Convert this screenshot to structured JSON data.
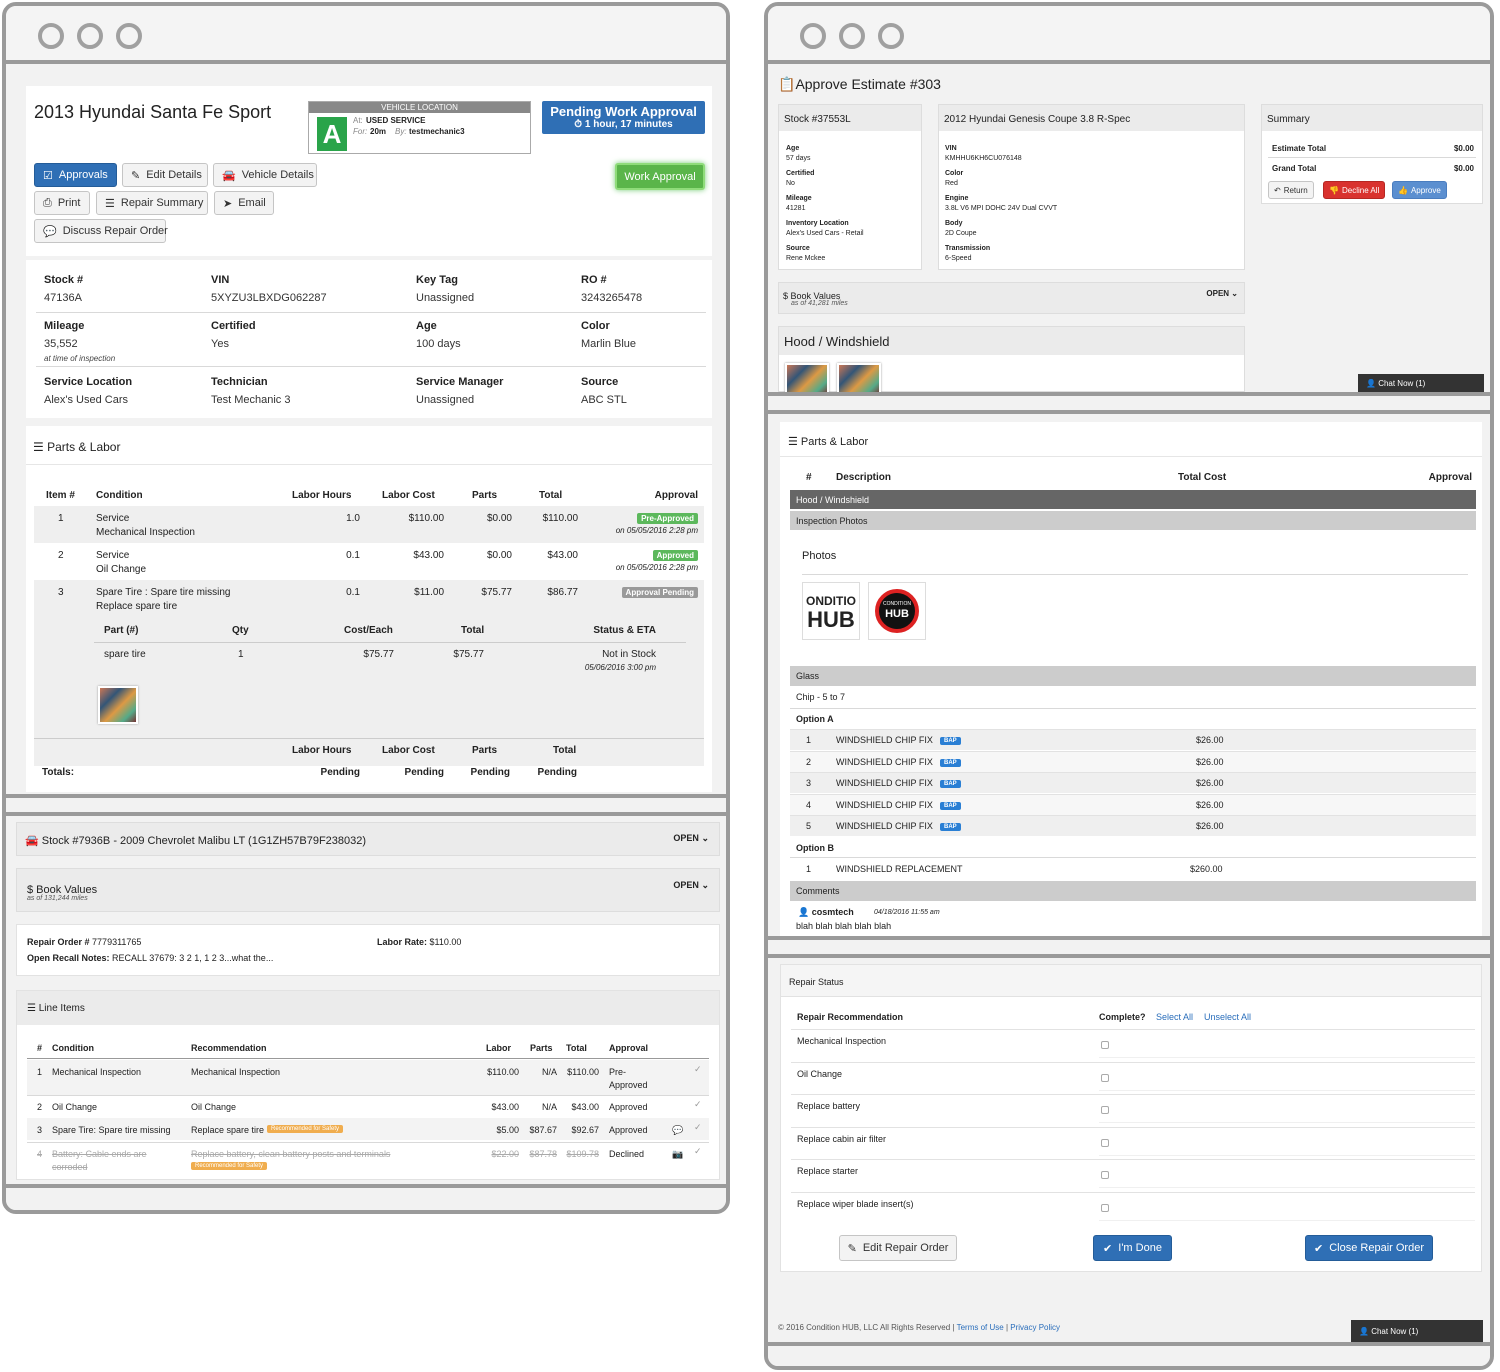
{
  "w1": {
    "vehicle_title": "2013 Hyundai Santa Fe Sport",
    "location_header": "VEHICLE LOCATION",
    "grade": "A",
    "at_label": "At:",
    "at_value": "USED SERVICE",
    "for_label": "For:",
    "for_value": "20m",
    "by_label": "By:",
    "by_value": "testmechanic3",
    "pending_title": "Pending Work Approval",
    "pending_time": "1 hour, 17 minutes",
    "work_approval": "Work Approval",
    "buttons": {
      "approvals": "Approvals",
      "edit": "Edit Details",
      "vehicle": "Vehicle Details",
      "print": "Print",
      "repair_summary": "Repair Summary",
      "email": "Email",
      "discuss": "Discuss Repair Order"
    },
    "info": [
      {
        "label": "Stock #",
        "value": "47136A"
      },
      {
        "label": "VIN",
        "value": "5XYZU3LBXDG062287"
      },
      {
        "label": "Key Tag",
        "value": "Unassigned"
      },
      {
        "label": "RO #",
        "value": "3243265478"
      },
      {
        "label": "Mileage",
        "value": "35,552",
        "note": "at time of inspection"
      },
      {
        "label": "Certified",
        "value": "Yes"
      },
      {
        "label": "Age",
        "value": "100 days"
      },
      {
        "label": "Color",
        "value": "Marlin Blue"
      },
      {
        "label": "Service Location",
        "value": "Alex's Used Cars"
      },
      {
        "label": "Technician",
        "value": "Test Mechanic 3"
      },
      {
        "label": "Service Manager",
        "value": "Unassigned"
      },
      {
        "label": "Source",
        "value": "ABC STL"
      }
    ],
    "parts_title": "Parts & Labor",
    "headers": [
      "Item #",
      "Condition",
      "Labor Hours",
      "Labor Cost",
      "Parts",
      "Total",
      "Approval"
    ],
    "rows": [
      {
        "n": "1",
        "c1": "Service",
        "c2": "Mechanical Inspection",
        "hours": "1.0",
        "cost": "$110.00",
        "parts": "$0.00",
        "total": "$110.00",
        "badge": "Pre-Approved",
        "date": "on 05/05/2016 2:28 pm"
      },
      {
        "n": "2",
        "c1": "Service",
        "c2": "Oil Change",
        "hours": "0.1",
        "cost": "$43.00",
        "parts": "$0.00",
        "total": "$43.00",
        "badge": "Approved",
        "date": "on 05/05/2016 2:28 pm"
      },
      {
        "n": "3",
        "c1": "Spare Tire : Spare tire missing",
        "c2": "Replace spare tire",
        "hours": "0.1",
        "cost": "$11.00",
        "parts": "$75.77",
        "total": "$86.77",
        "badge": "Approval Pending",
        "date": ""
      }
    ],
    "sub_headers": [
      "Part (#)",
      "Qty",
      "Cost/Each",
      "Total",
      "Status & ETA"
    ],
    "sub_row": {
      "part": "spare tire",
      "qty": "1",
      "cost": "$75.77",
      "total": "$75.77",
      "status": "Not in Stock",
      "eta": "05/06/2016 3:00 pm"
    },
    "totals_headers": [
      "Labor Hours",
      "Labor Cost",
      "Parts",
      "Total"
    ],
    "totals_label": "Totals:",
    "totals_values": [
      "Pending",
      "Pending",
      "Pending",
      "Pending"
    ]
  },
  "w1b": {
    "stock_title": "Stock #7936B - 2009 Chevrolet Malibu LT (1G1ZH57B79F238032)",
    "open": "OPEN",
    "book_values": "$ Book Values",
    "book_miles": "as of 131,244 miles",
    "ro_label": "Repair Order #",
    "ro_value": "7779311765",
    "labor_rate_label": "Labor Rate:",
    "labor_rate_value": "$110.00",
    "recall_label": "Open Recall Notes:",
    "recall_value": "RECALL 37679: 3 2 1, 1 2 3...what the...",
    "line_items_title": "Line Items",
    "headers": [
      "#",
      "Condition",
      "Recommendation",
      "Labor",
      "Parts",
      "Total",
      "Approval"
    ],
    "rows": [
      {
        "n": "1",
        "cond": "Mechanical Inspection",
        "rec": "Mechanical Inspection",
        "labor": "$110.00",
        "parts": "N/A",
        "total": "$110.00",
        "appr": "Pre-",
        "appr2": "Approved",
        "tag": ""
      },
      {
        "n": "2",
        "cond": "Oil Change",
        "rec": "Oil Change",
        "labor": "$43.00",
        "parts": "N/A",
        "total": "$43.00",
        "appr": "Approved",
        "appr2": "",
        "tag": ""
      },
      {
        "n": "3",
        "cond": "Spare Tire: Spare tire missing",
        "rec": "Replace spare tire",
        "labor": "$5.00",
        "parts": "$87.67",
        "total": "$92.67",
        "appr": "Approved",
        "appr2": "",
        "tag": "Recommended for Safety"
      },
      {
        "n": "4",
        "cond": "Battery: Cable ends are",
        "cond2": "corroded",
        "rec": "Replace battery, clean battery posts and terminals",
        "labor": "$22.00",
        "parts": "$87.78",
        "total": "$109.78",
        "appr": "Declined",
        "appr2": "",
        "tag": "Recommended for Safety"
      }
    ]
  },
  "w2": {
    "title": "Approve Estimate #303",
    "stock": "Stock #37553L",
    "stock_fields": [
      {
        "l": "Age",
        "v": "57 days"
      },
      {
        "l": "Certified",
        "v": "No"
      },
      {
        "l": "Mileage",
        "v": "41281"
      },
      {
        "l": "Inventory Location",
        "v": "Alex's Used Cars - Retail"
      },
      {
        "l": "Source",
        "v": "Rene Mckee"
      }
    ],
    "vehicle": "2012 Hyundai Genesis Coupe 3.8 R-Spec",
    "vehicle_fields": [
      {
        "l": "VIN",
        "v": "KMHHU6KH6CU076148"
      },
      {
        "l": "Color",
        "v": "Red"
      },
      {
        "l": "Engine",
        "v": "3.8L V6 MPI DOHC 24V Dual CVVT"
      },
      {
        "l": "Body",
        "v": "2D Coupe"
      },
      {
        "l": "Transmission",
        "v": "6-Speed"
      }
    ],
    "summary": "Summary",
    "estimate_total": "Estimate Total",
    "estimate_val": "$0.00",
    "grand_total": "Grand Total",
    "grand_val": "$0.00",
    "return": "Return",
    "decline_all": "Decline All",
    "approve": "Approve",
    "book_values": "$ Book Values",
    "book_miles": "as of 41,281 miles",
    "open": "OPEN",
    "hood": "Hood / Windshield",
    "chat": "Chat Now (1)"
  },
  "w3": {
    "title": "Parts & Labor",
    "headers": [
      "#",
      "Description",
      "Total Cost",
      "Approval"
    ],
    "group": "Hood / Windshield",
    "inspection_photos": "Inspection Photos",
    "photos": "Photos",
    "logo1": "ONDITIO",
    "logo1b": "HUB",
    "logo2": "CONDITION",
    "logo2b": "HUB",
    "glass": "Glass",
    "chip": "Chip - 5 to 7",
    "option_a": "Option A",
    "a_rows": [
      {
        "n": "1",
        "d": "WINDSHIELD CHIP FIX",
        "p": "$26.00"
      },
      {
        "n": "2",
        "d": "WINDSHIELD CHIP FIX",
        "p": "$26.00"
      },
      {
        "n": "3",
        "d": "WINDSHIELD CHIP FIX",
        "p": "$26.00"
      },
      {
        "n": "4",
        "d": "WINDSHIELD CHIP FIX",
        "p": "$26.00"
      },
      {
        "n": "5",
        "d": "WINDSHIELD CHIP FIX",
        "p": "$26.00"
      }
    ],
    "bap": "BAP",
    "option_b": "Option B",
    "b_row": {
      "n": "1",
      "d": "WINDSHIELD REPLACEMENT",
      "p": "$260.00"
    },
    "comments": "Comments",
    "user": "cosmtech",
    "date": "04/18/2016 11:55 am",
    "comment": "blah blah blah blah blah"
  },
  "w4": {
    "title": "Repair Status",
    "rec_header": "Repair Recommendation",
    "complete": "Complete?",
    "select_all": "Select All",
    "unselect_all": "Unselect All",
    "items": [
      "Mechanical Inspection",
      "Oil Change",
      "Replace battery",
      "Replace cabin air filter",
      "Replace starter",
      "Replace wiper blade insert(s)"
    ],
    "edit": "Edit Repair Order",
    "done": "I'm Done",
    "close": "Close Repair Order",
    "footer": "© 2016 Condition HUB, LLC All Rights Reserved |",
    "terms": "Terms of Use",
    "sep": "|",
    "privacy": "Privacy Policy",
    "chat": "Chat Now (1)"
  },
  "colors": {
    "blue": "#2f6fb5",
    "green": "#5cb85c",
    "red": "#d9322e",
    "orange": "#f0ad4e",
    "grey_badge": "#999999",
    "bap": "#2a7fd4"
  }
}
